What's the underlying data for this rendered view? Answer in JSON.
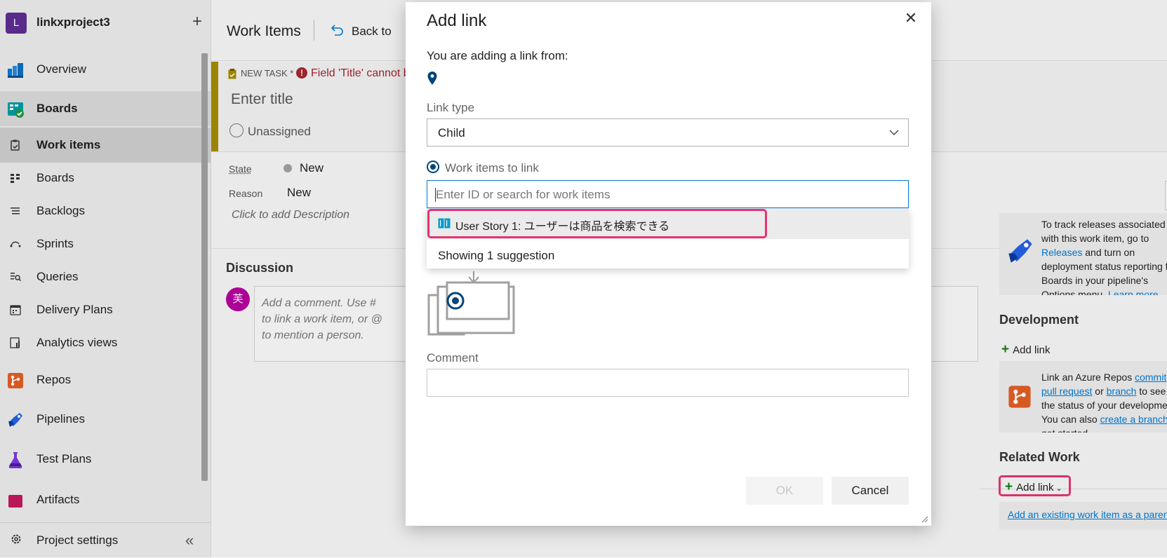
{
  "sidebar": {
    "project_initial": "L",
    "project_name": "linkxproject3",
    "add_icon": "plus-icon",
    "items": {
      "overview": "Overview",
      "boards": "Boards",
      "work_items": "Work items",
      "boards_sub": "Boards",
      "backlogs": "Backlogs",
      "sprints": "Sprints",
      "queries": "Queries",
      "delivery_plans": "Delivery Plans",
      "analytics_views": "Analytics views",
      "repos": "Repos",
      "pipelines": "Pipelines",
      "test_plans": "Test Plans",
      "artifacts": "Artifacts"
    },
    "project_settings": "Project settings",
    "collapse_glyph": "«"
  },
  "main": {
    "page_title": "Work Items",
    "back_link": "Back to",
    "task_type": "NEW TASK *",
    "error_icon_glyph": "!",
    "error_text": "Field 'Title' cannot be empty.",
    "title_placeholder": "Enter title",
    "assignee": "Unassigned",
    "state_label": "State",
    "state_value": "New",
    "reason_label": "Reason",
    "reason_value": "New",
    "description_placeholder": "Click to add Description",
    "discussion_title": "Discussion",
    "comment_avatar": "芙",
    "comment_placeholder": "Add a comment. Use # to link a work item, or @ to mention a person."
  },
  "right_panel": {
    "deploy_text_1": "To track releases associated with this work item, go to ",
    "deploy_link_1": "Releases",
    "deploy_text_2": " and turn on deployment status reporting for Boards in your pipeline's Options menu. ",
    "deploy_link_2": "Learn more about deployment status reporting",
    "development_title": "Development",
    "dev_add_link": "Add link",
    "dev_text_1": "Link an Azure Repos ",
    "dev_link_commit": "commit",
    "dev_text_2": ", ",
    "dev_link_pr": "pull request",
    "dev_text_3": " or ",
    "dev_link_branch": "branch",
    "dev_text_4": " to see the status of your development. You can also ",
    "dev_link_create": "create a branch",
    "dev_text_5": " to get started.",
    "related_title": "Related Work",
    "related_add_link": "Add link",
    "related_chevron": "⌄",
    "existing_link": "Add an existing work item as a parent"
  },
  "dialog": {
    "title": "Add link",
    "close_glyph": "✕",
    "from_label": "You are adding a link from:",
    "link_type_label": "Link type",
    "link_type_value": "Child",
    "work_items_label": "Work items to link",
    "search_placeholder": "Enter ID or search for work items",
    "suggestion": "User Story 1: ユーザーは商品を検索できる",
    "suggestion_count": "Showing 1 suggestion",
    "comment_label": "Comment",
    "ok": "OK",
    "cancel": "Cancel"
  },
  "colors": {
    "accent": "#0078d4",
    "highlight": "#e8336d",
    "task_accent": "#a38a00",
    "error": "#a4262c",
    "project_avatar": "#5c2d91"
  }
}
